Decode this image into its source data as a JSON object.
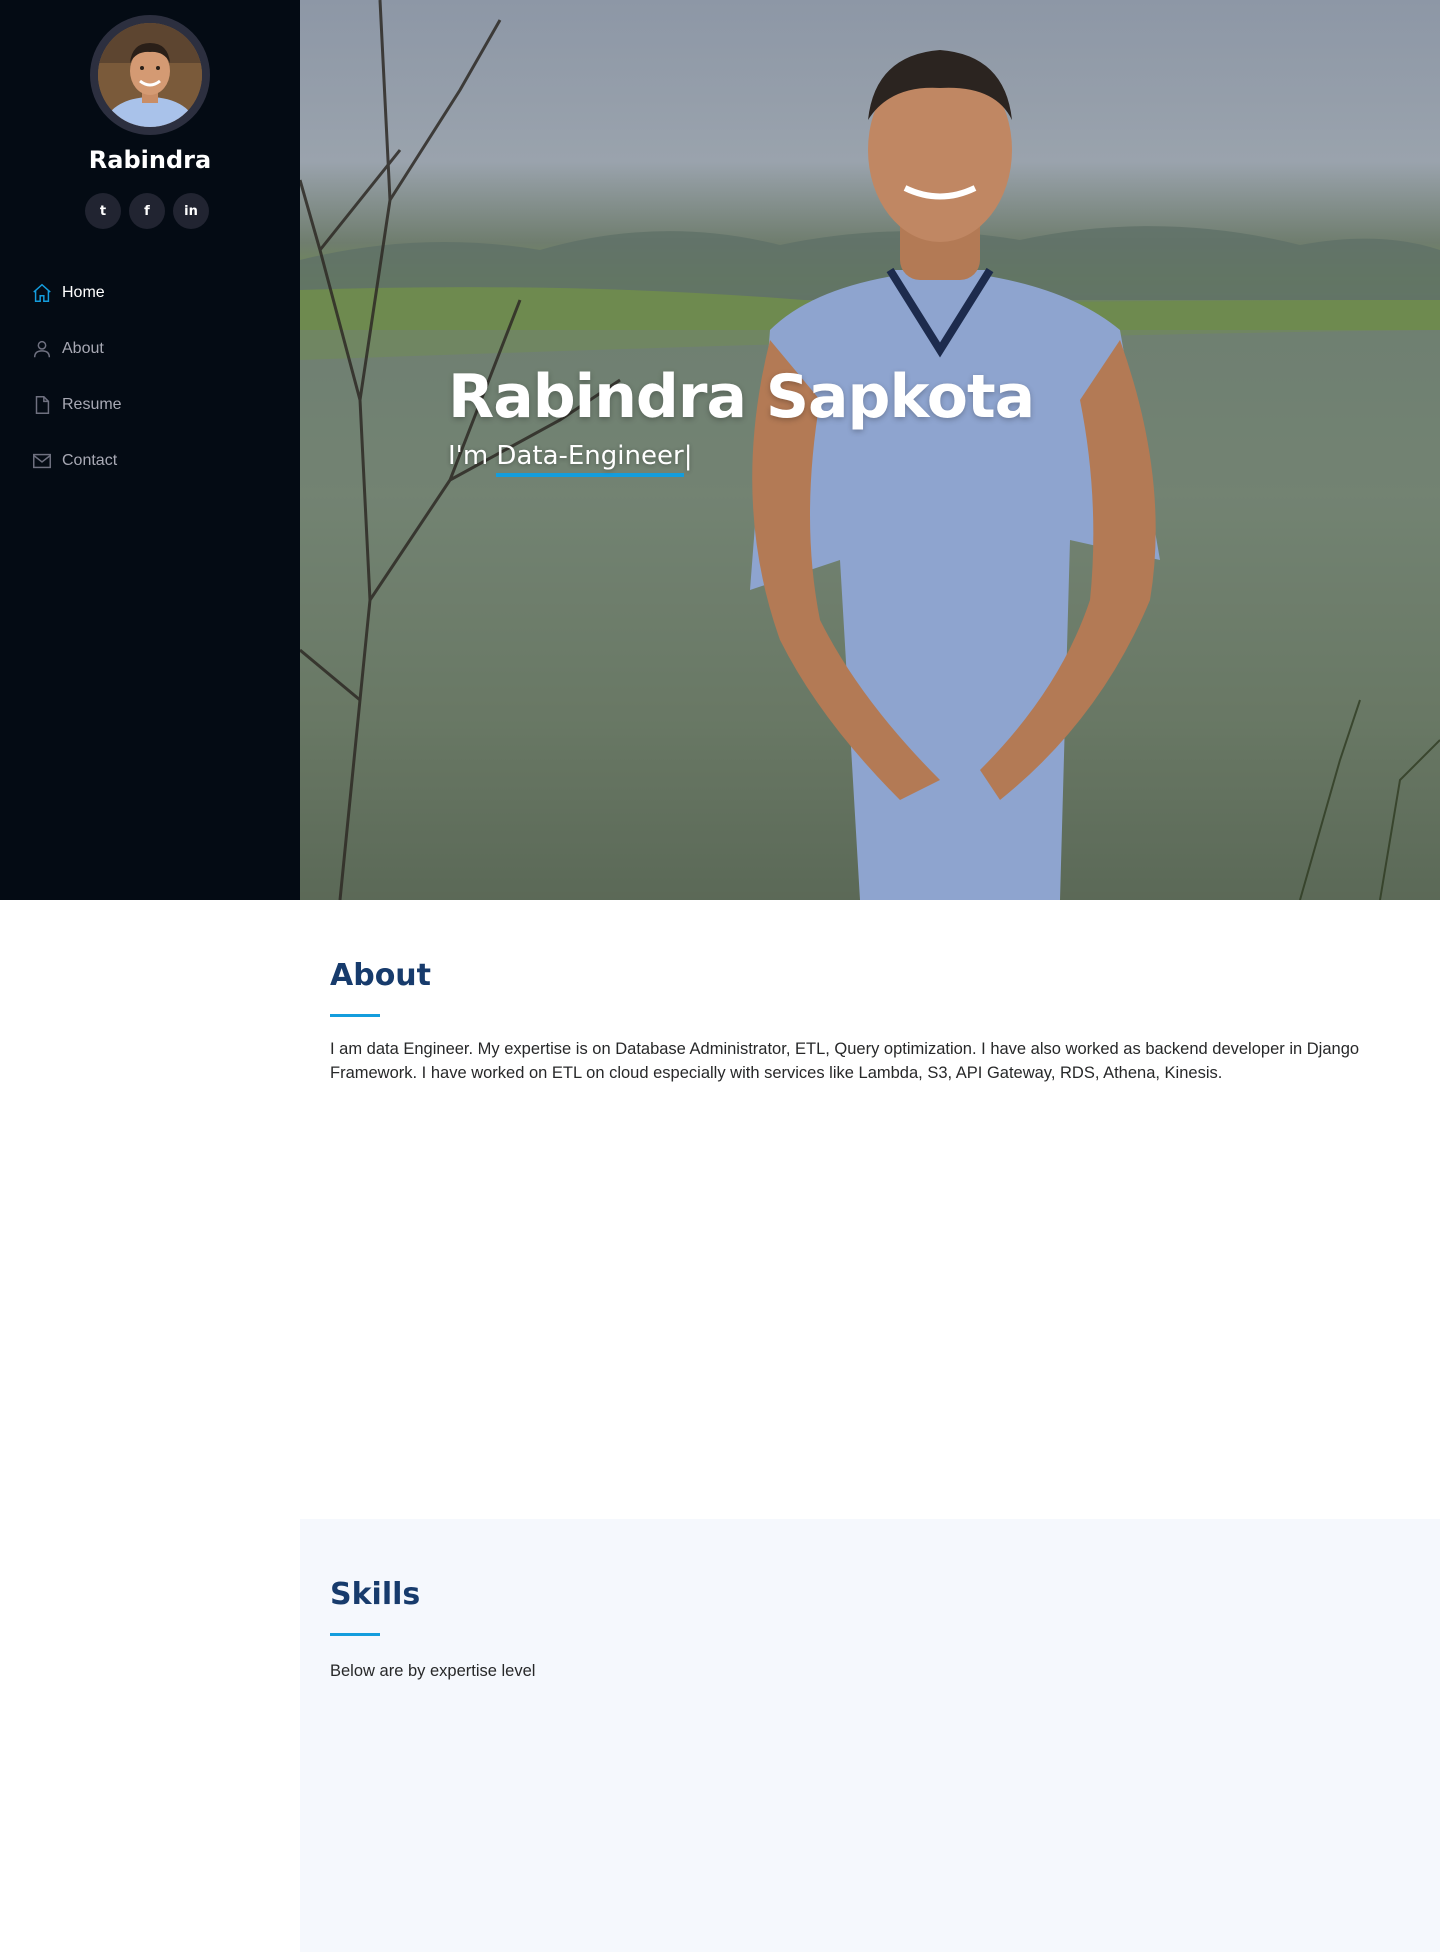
{
  "sidebar": {
    "avatar_alt": "profile photo",
    "name": "Rabindra",
    "social": [
      {
        "icon": "twitter-icon",
        "glyph": "t"
      },
      {
        "icon": "facebook-icon",
        "glyph": "f"
      },
      {
        "icon": "linkedin-icon",
        "glyph": "in"
      }
    ],
    "nav": [
      {
        "label": "Home",
        "icon": "home-icon",
        "active": true
      },
      {
        "label": "About",
        "icon": "person-icon",
        "active": false
      },
      {
        "label": "Resume",
        "icon": "file-icon",
        "active": false
      },
      {
        "label": "Contact",
        "icon": "envelope-icon",
        "active": false
      }
    ]
  },
  "hero": {
    "title": "Rabindra Sapkota",
    "prefix": "I'm ",
    "typed": "Data-Engineer",
    "cursor": "|"
  },
  "about": {
    "title": "About",
    "text": "I am data Engineer. My expertise is on Database Administrator, ETL, Query optimization. I have also worked as backend developer in Django Framework. I have worked on ETL on cloud especially with services like Lambda, S3, API Gateway, RDS, Athena, Kinesis."
  },
  "skills": {
    "title": "Skills",
    "text": "Below are by expertise level"
  },
  "colors": {
    "sidebar_bg": "#040b14",
    "accent": "#149ddd",
    "heading": "#173b6c",
    "skills_bg": "#f5f8fd"
  }
}
